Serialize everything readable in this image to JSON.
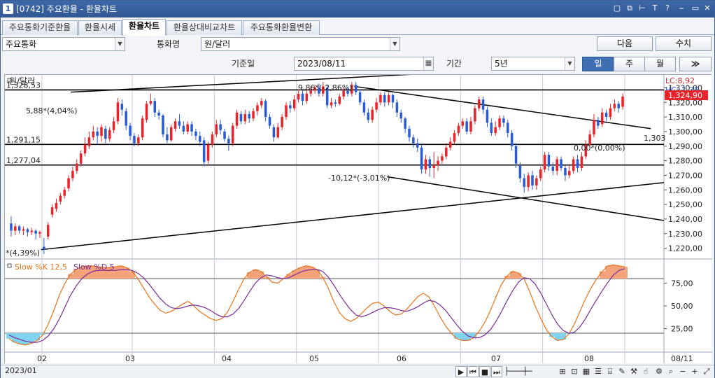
{
  "window": {
    "id": "1",
    "title": "[0742] 주요환율 - 환율차트",
    "buttons": [
      "restore-layout",
      "copy",
      "pin",
      "text",
      "help",
      "separator",
      "minimize",
      "close"
    ]
  },
  "tabs": [
    {
      "label": "주요통화기준환율",
      "active": false
    },
    {
      "label": "환율시세",
      "active": false
    },
    {
      "label": "환율차트",
      "active": true
    },
    {
      "label": "환율상대비교차트",
      "active": false
    },
    {
      "label": "주요통화환율변환",
      "active": false
    }
  ],
  "controls": {
    "category_value": "주요통화",
    "currency_label": "통화명",
    "currency_value": "원/달러",
    "next_label": "다음",
    "value_label": "수치",
    "date_label": "기준일",
    "date_value": "2023/08/11",
    "period_label": "기간",
    "period_value": "5년",
    "periods": [
      {
        "label": "일",
        "active": true
      },
      {
        "label": "주",
        "active": false
      },
      {
        "label": "월",
        "active": false
      }
    ],
    "more_label": "≫"
  },
  "chart_data": {
    "type": "candlestick",
    "title": "원/달러",
    "lc_label": "LC:8,92",
    "hc_label": "HC:-1,35",
    "current_price_label": "1,324,90",
    "price_axis_ticks": [
      "1,330,00",
      "1,320,00",
      "1,310,00",
      "1,300,00",
      "1,290,00",
      "1,280,00",
      "1,270,00",
      "1,260,00",
      "1,250,00",
      "1,240,00",
      "1,230,00",
      "1,220,00"
    ],
    "ylim": [
      1215,
      1335
    ],
    "horizontal_levels": [
      {
        "value": 1328.53,
        "label": "1,328,53"
      },
      {
        "value": 1291.15,
        "label": "1,291,15"
      },
      {
        "value": 1277.04,
        "label": "1,277,04"
      }
    ],
    "annotations": [
      "5,88*(4,04%)",
      "9,86*(-2,86%)",
      "-10,12*(-3,01%)",
      "0,00*(0,00%)",
      "1,303",
      "*(4,39%)"
    ],
    "x_labels": [
      "2023/01",
      "02",
      "03",
      "04",
      "05",
      "06",
      "07",
      "08",
      "08/11"
    ],
    "candles": [
      {
        "o": 1237,
        "c": 1232,
        "h": 1242,
        "l": 1228
      },
      {
        "o": 1232,
        "c": 1235,
        "h": 1237,
        "l": 1229
      },
      {
        "o": 1235,
        "c": 1232,
        "h": 1236,
        "l": 1230
      },
      {
        "o": 1232,
        "c": 1233,
        "h": 1235,
        "l": 1229
      },
      {
        "o": 1233,
        "c": 1231,
        "h": 1234,
        "l": 1228
      },
      {
        "o": 1231,
        "c": 1232,
        "h": 1234,
        "l": 1229
      },
      {
        "o": 1232,
        "c": 1230,
        "h": 1233,
        "l": 1226
      },
      {
        "o": 1230,
        "c": 1231,
        "h": 1232,
        "l": 1227
      },
      {
        "o": 1221,
        "c": 1219,
        "h": 1227,
        "l": 1216
      },
      {
        "o": 1228,
        "c": 1236,
        "h": 1238,
        "l": 1226
      },
      {
        "o": 1243,
        "c": 1248,
        "h": 1250,
        "l": 1241
      },
      {
        "o": 1247,
        "c": 1251,
        "h": 1254,
        "l": 1245
      },
      {
        "o": 1252,
        "c": 1256,
        "h": 1258,
        "l": 1250
      },
      {
        "o": 1256,
        "c": 1260,
        "h": 1262,
        "l": 1254
      },
      {
        "o": 1261,
        "c": 1268,
        "h": 1270,
        "l": 1259
      },
      {
        "o": 1268,
        "c": 1273,
        "h": 1276,
        "l": 1266
      },
      {
        "o": 1273,
        "c": 1278,
        "h": 1281,
        "l": 1271
      },
      {
        "o": 1278,
        "c": 1285,
        "h": 1287,
        "l": 1276
      },
      {
        "o": 1285,
        "c": 1291,
        "h": 1296,
        "l": 1283
      },
      {
        "o": 1290,
        "c": 1296,
        "h": 1300,
        "l": 1288
      },
      {
        "o": 1296,
        "c": 1300,
        "h": 1304,
        "l": 1294
      },
      {
        "o": 1300,
        "c": 1297,
        "h": 1303,
        "l": 1291
      },
      {
        "o": 1297,
        "c": 1303,
        "h": 1305,
        "l": 1293
      },
      {
        "o": 1302,
        "c": 1295,
        "h": 1304,
        "l": 1292
      },
      {
        "o": 1295,
        "c": 1301,
        "h": 1303,
        "l": 1293
      },
      {
        "o": 1301,
        "c": 1307,
        "h": 1310,
        "l": 1299
      },
      {
        "o": 1307,
        "c": 1320,
        "h": 1323,
        "l": 1305
      },
      {
        "o": 1319,
        "c": 1315,
        "h": 1322,
        "l": 1311
      },
      {
        "o": 1314,
        "c": 1304,
        "h": 1316,
        "l": 1301
      },
      {
        "o": 1304,
        "c": 1297,
        "h": 1306,
        "l": 1294
      },
      {
        "o": 1297,
        "c": 1292,
        "h": 1299,
        "l": 1290
      },
      {
        "o": 1292,
        "c": 1296,
        "h": 1298,
        "l": 1290
      },
      {
        "o": 1296,
        "c": 1309,
        "h": 1311,
        "l": 1294
      },
      {
        "o": 1308,
        "c": 1319,
        "h": 1321,
        "l": 1306
      },
      {
        "o": 1319,
        "c": 1321,
        "h": 1326,
        "l": 1318
      },
      {
        "o": 1321,
        "c": 1313,
        "h": 1323,
        "l": 1310
      },
      {
        "o": 1313,
        "c": 1311,
        "h": 1315,
        "l": 1308
      },
      {
        "o": 1311,
        "c": 1298,
        "h": 1312,
        "l": 1296
      },
      {
        "o": 1298,
        "c": 1294,
        "h": 1303,
        "l": 1292
      },
      {
        "o": 1294,
        "c": 1303,
        "h": 1305,
        "l": 1293
      },
      {
        "o": 1302,
        "c": 1307,
        "h": 1309,
        "l": 1300
      },
      {
        "o": 1307,
        "c": 1304,
        "h": 1312,
        "l": 1302
      },
      {
        "o": 1304,
        "c": 1300,
        "h": 1307,
        "l": 1298
      },
      {
        "o": 1300,
        "c": 1305,
        "h": 1307,
        "l": 1298
      },
      {
        "o": 1305,
        "c": 1300,
        "h": 1307,
        "l": 1297
      },
      {
        "o": 1300,
        "c": 1297,
        "h": 1302,
        "l": 1294
      },
      {
        "o": 1297,
        "c": 1293,
        "h": 1300,
        "l": 1290
      },
      {
        "o": 1294,
        "c": 1279,
        "h": 1296,
        "l": 1276
      },
      {
        "o": 1280,
        "c": 1291,
        "h": 1293,
        "l": 1278
      },
      {
        "o": 1291,
        "c": 1298,
        "h": 1300,
        "l": 1289
      },
      {
        "o": 1298,
        "c": 1305,
        "h": 1308,
        "l": 1296
      },
      {
        "o": 1305,
        "c": 1301,
        "h": 1308,
        "l": 1298
      },
      {
        "o": 1300,
        "c": 1295,
        "h": 1302,
        "l": 1293
      },
      {
        "o": 1295,
        "c": 1292,
        "h": 1297,
        "l": 1287
      },
      {
        "o": 1292,
        "c": 1304,
        "h": 1306,
        "l": 1290
      },
      {
        "o": 1304,
        "c": 1313,
        "h": 1315,
        "l": 1302
      },
      {
        "o": 1312,
        "c": 1307,
        "h": 1314,
        "l": 1305
      },
      {
        "o": 1307,
        "c": 1312,
        "h": 1315,
        "l": 1305
      },
      {
        "o": 1312,
        "c": 1309,
        "h": 1314,
        "l": 1306
      },
      {
        "o": 1309,
        "c": 1314,
        "h": 1316,
        "l": 1307
      },
      {
        "o": 1314,
        "c": 1318,
        "h": 1320,
        "l": 1311
      },
      {
        "o": 1318,
        "c": 1321,
        "h": 1323,
        "l": 1316
      },
      {
        "o": 1321,
        "c": 1310,
        "h": 1322,
        "l": 1307
      },
      {
        "o": 1310,
        "c": 1304,
        "h": 1312,
        "l": 1302
      },
      {
        "o": 1303,
        "c": 1296,
        "h": 1305,
        "l": 1293
      },
      {
        "o": 1296,
        "c": 1303,
        "h": 1306,
        "l": 1295
      },
      {
        "o": 1303,
        "c": 1310,
        "h": 1312,
        "l": 1301
      },
      {
        "o": 1310,
        "c": 1318,
        "h": 1320,
        "l": 1308
      },
      {
        "o": 1318,
        "c": 1316,
        "h": 1321,
        "l": 1313
      },
      {
        "o": 1316,
        "c": 1322,
        "h": 1325,
        "l": 1314
      },
      {
        "o": 1322,
        "c": 1326,
        "h": 1329,
        "l": 1320
      },
      {
        "o": 1326,
        "c": 1321,
        "h": 1328,
        "l": 1318
      },
      {
        "o": 1321,
        "c": 1326,
        "h": 1329,
        "l": 1319
      },
      {
        "o": 1326,
        "c": 1328,
        "h": 1331,
        "l": 1324
      },
      {
        "o": 1328,
        "c": 1330,
        "h": 1332,
        "l": 1326
      },
      {
        "o": 1330,
        "c": 1326,
        "h": 1333,
        "l": 1324
      },
      {
        "o": 1326,
        "c": 1331,
        "h": 1334,
        "l": 1324
      },
      {
        "o": 1330,
        "c": 1318,
        "h": 1332,
        "l": 1316
      },
      {
        "o": 1318,
        "c": 1320,
        "h": 1323,
        "l": 1316
      },
      {
        "o": 1320,
        "c": 1319,
        "h": 1322,
        "l": 1317
      },
      {
        "o": 1319,
        "c": 1324,
        "h": 1326,
        "l": 1318
      },
      {
        "o": 1324,
        "c": 1328,
        "h": 1330,
        "l": 1322
      },
      {
        "o": 1328,
        "c": 1326,
        "h": 1331,
        "l": 1324
      },
      {
        "o": 1326,
        "c": 1332,
        "h": 1334,
        "l": 1324
      },
      {
        "o": 1332,
        "c": 1327,
        "h": 1334,
        "l": 1325
      },
      {
        "o": 1327,
        "c": 1320,
        "h": 1329,
        "l": 1318
      },
      {
        "o": 1320,
        "c": 1313,
        "h": 1322,
        "l": 1311
      },
      {
        "o": 1313,
        "c": 1308,
        "h": 1316,
        "l": 1306
      },
      {
        "o": 1308,
        "c": 1315,
        "h": 1317,
        "l": 1306
      },
      {
        "o": 1315,
        "c": 1320,
        "h": 1323,
        "l": 1313
      },
      {
        "o": 1320,
        "c": 1325,
        "h": 1327,
        "l": 1318
      },
      {
        "o": 1325,
        "c": 1320,
        "h": 1327,
        "l": 1317
      },
      {
        "o": 1320,
        "c": 1325,
        "h": 1327,
        "l": 1318
      },
      {
        "o": 1325,
        "c": 1320,
        "h": 1326,
        "l": 1316
      },
      {
        "o": 1320,
        "c": 1313,
        "h": 1322,
        "l": 1310
      },
      {
        "o": 1313,
        "c": 1309,
        "h": 1315,
        "l": 1306
      },
      {
        "o": 1309,
        "c": 1302,
        "h": 1310,
        "l": 1299
      },
      {
        "o": 1302,
        "c": 1296,
        "h": 1304,
        "l": 1293
      },
      {
        "o": 1296,
        "c": 1292,
        "h": 1298,
        "l": 1289
      },
      {
        "o": 1292,
        "c": 1289,
        "h": 1295,
        "l": 1286
      },
      {
        "o": 1289,
        "c": 1274,
        "h": 1291,
        "l": 1271
      },
      {
        "o": 1274,
        "c": 1281,
        "h": 1284,
        "l": 1271
      },
      {
        "o": 1281,
        "c": 1275,
        "h": 1283,
        "l": 1269
      },
      {
        "o": 1275,
        "c": 1277,
        "h": 1286,
        "l": 1268
      },
      {
        "o": 1277,
        "c": 1280,
        "h": 1283,
        "l": 1273
      },
      {
        "o": 1280,
        "c": 1283,
        "h": 1285,
        "l": 1278
      },
      {
        "o": 1283,
        "c": 1289,
        "h": 1292,
        "l": 1281
      },
      {
        "o": 1289,
        "c": 1293,
        "h": 1296,
        "l": 1287
      },
      {
        "o": 1293,
        "c": 1299,
        "h": 1301,
        "l": 1291
      },
      {
        "o": 1299,
        "c": 1304,
        "h": 1306,
        "l": 1297
      },
      {
        "o": 1304,
        "c": 1307,
        "h": 1309,
        "l": 1302
      },
      {
        "o": 1307,
        "c": 1300,
        "h": 1309,
        "l": 1298
      },
      {
        "o": 1300,
        "c": 1307,
        "h": 1310,
        "l": 1298
      },
      {
        "o": 1307,
        "c": 1316,
        "h": 1318,
        "l": 1305
      },
      {
        "o": 1316,
        "c": 1322,
        "h": 1324,
        "l": 1314
      },
      {
        "o": 1322,
        "c": 1315,
        "h": 1324,
        "l": 1312
      },
      {
        "o": 1315,
        "c": 1306,
        "h": 1317,
        "l": 1303
      },
      {
        "o": 1306,
        "c": 1299,
        "h": 1309,
        "l": 1297
      },
      {
        "o": 1299,
        "c": 1303,
        "h": 1307,
        "l": 1297
      },
      {
        "o": 1303,
        "c": 1309,
        "h": 1311,
        "l": 1301
      },
      {
        "o": 1309,
        "c": 1306,
        "h": 1311,
        "l": 1303
      },
      {
        "o": 1306,
        "c": 1299,
        "h": 1308,
        "l": 1296
      },
      {
        "o": 1299,
        "c": 1290,
        "h": 1301,
        "l": 1287
      },
      {
        "o": 1290,
        "c": 1278,
        "h": 1292,
        "l": 1275
      },
      {
        "o": 1277,
        "c": 1268,
        "h": 1279,
        "l": 1265
      },
      {
        "o": 1268,
        "c": 1262,
        "h": 1271,
        "l": 1258
      },
      {
        "o": 1262,
        "c": 1270,
        "h": 1272,
        "l": 1259
      },
      {
        "o": 1270,
        "c": 1263,
        "h": 1273,
        "l": 1260
      },
      {
        "o": 1263,
        "c": 1268,
        "h": 1270,
        "l": 1260
      },
      {
        "o": 1268,
        "c": 1274,
        "h": 1276,
        "l": 1266
      },
      {
        "o": 1274,
        "c": 1284,
        "h": 1286,
        "l": 1272
      },
      {
        "o": 1284,
        "c": 1276,
        "h": 1286,
        "l": 1273
      },
      {
        "o": 1276,
        "c": 1273,
        "h": 1279,
        "l": 1270
      },
      {
        "o": 1273,
        "c": 1281,
        "h": 1283,
        "l": 1270
      },
      {
        "o": 1281,
        "c": 1275,
        "h": 1283,
        "l": 1273
      },
      {
        "o": 1275,
        "c": 1270,
        "h": 1277,
        "l": 1266
      },
      {
        "o": 1270,
        "c": 1273,
        "h": 1277,
        "l": 1268
      },
      {
        "o": 1273,
        "c": 1281,
        "h": 1283,
        "l": 1271
      },
      {
        "o": 1281,
        "c": 1275,
        "h": 1284,
        "l": 1272
      },
      {
        "o": 1275,
        "c": 1283,
        "h": 1286,
        "l": 1273
      },
      {
        "o": 1283,
        "c": 1291,
        "h": 1294,
        "l": 1281
      },
      {
        "o": 1291,
        "c": 1298,
        "h": 1301,
        "l": 1289
      },
      {
        "o": 1298,
        "c": 1308,
        "h": 1312,
        "l": 1296
      },
      {
        "o": 1308,
        "c": 1304,
        "h": 1310,
        "l": 1302
      },
      {
        "o": 1305,
        "c": 1313,
        "h": 1316,
        "l": 1303
      },
      {
        "o": 1313,
        "c": 1310,
        "h": 1315,
        "l": 1307
      },
      {
        "o": 1310,
        "c": 1316,
        "h": 1319,
        "l": 1308
      },
      {
        "o": 1316,
        "c": 1319,
        "h": 1322,
        "l": 1314
      },
      {
        "o": 1319,
        "c": 1316,
        "h": 1321,
        "l": 1313
      },
      {
        "o": 1317,
        "c": 1324,
        "h": 1326,
        "l": 1315
      }
    ],
    "trend_lines": [
      {
        "x1": 0.055,
        "y1": 1219,
        "x2": 1.0,
        "y2": 1265
      },
      {
        "x1": 0.1,
        "y1": 1327,
        "x2": 0.65,
        "y2": 1340
      },
      {
        "x1": 0.53,
        "y1": 1331,
        "x2": 0.98,
        "y2": 1302
      },
      {
        "x1": 0.58,
        "y1": 1269,
        "x2": 1.0,
        "y2": 1239
      }
    ],
    "stochastic": {
      "title_k": "Slow %K 12,5",
      "title_d": "Slow %D 5",
      "ticks": [
        "75,00",
        "50,00",
        "25,00"
      ],
      "overbought": 80,
      "oversold": 20,
      "k": [
        14,
        10,
        8,
        7,
        9,
        12,
        18,
        30,
        45,
        62,
        75,
        85,
        90,
        93,
        94,
        94,
        93,
        92,
        92,
        93,
        94,
        92,
        88,
        80,
        70,
        60,
        52,
        45,
        42,
        44,
        48,
        52,
        55,
        50,
        44,
        40,
        36,
        34,
        36,
        43,
        55,
        68,
        80,
        87,
        90,
        88,
        82,
        76,
        75,
        80,
        85,
        89,
        92,
        94,
        93,
        90,
        82,
        70,
        55,
        43,
        36,
        33,
        36,
        42,
        48,
        53,
        54,
        50,
        44,
        40,
        41,
        46,
        53,
        60,
        64,
        60,
        50,
        38,
        28,
        20,
        14,
        12,
        12,
        15,
        22,
        32,
        45,
        60,
        74,
        83,
        88,
        86,
        80,
        66,
        50,
        36,
        24,
        16,
        12,
        13,
        19,
        30,
        44,
        58,
        70,
        80,
        88,
        94,
        95,
        94,
        93
      ],
      "d": [
        18,
        15,
        13,
        11,
        10,
        10,
        12,
        17,
        25,
        36,
        49,
        62,
        72,
        80,
        85,
        88,
        89,
        89,
        89,
        89,
        90,
        90,
        89,
        86,
        81,
        74,
        66,
        58,
        52,
        48,
        47,
        48,
        50,
        51,
        50,
        48,
        45,
        41,
        38,
        38,
        41,
        47,
        56,
        66,
        75,
        81,
        84,
        83,
        81,
        80,
        81,
        84,
        87,
        89,
        90,
        90,
        88,
        82,
        73,
        63,
        54,
        46,
        40,
        38,
        40,
        43,
        46,
        48,
        48,
        47,
        45,
        44,
        46,
        49,
        53,
        56,
        55,
        51,
        45,
        37,
        29,
        22,
        17,
        15,
        15,
        18,
        24,
        33,
        44,
        56,
        67,
        76,
        81,
        80,
        74,
        64,
        52,
        40,
        30,
        23,
        20,
        21,
        27,
        36,
        47,
        57,
        67,
        76,
        84,
        89,
        91
      ]
    }
  },
  "x_axis_ticks_text": "02 03 04 05 06 07 08",
  "statusbar": {
    "icons": [
      "play",
      "first",
      "stop",
      "last",
      "zoom-slider",
      "fit",
      "view",
      "grid",
      "pencil",
      "pointer",
      "magnify",
      "minus",
      "plus",
      "expand"
    ]
  },
  "colors": {
    "up": "#e8232a",
    "down": "#2a5bd7",
    "k_line": "#e8731a",
    "d_line": "#7a2d9b",
    "k_fill_high": "#f4a27a",
    "k_fill_low": "#7fd3ef",
    "active_tab": "#ffffff",
    "accent": "#3f6fb3"
  }
}
